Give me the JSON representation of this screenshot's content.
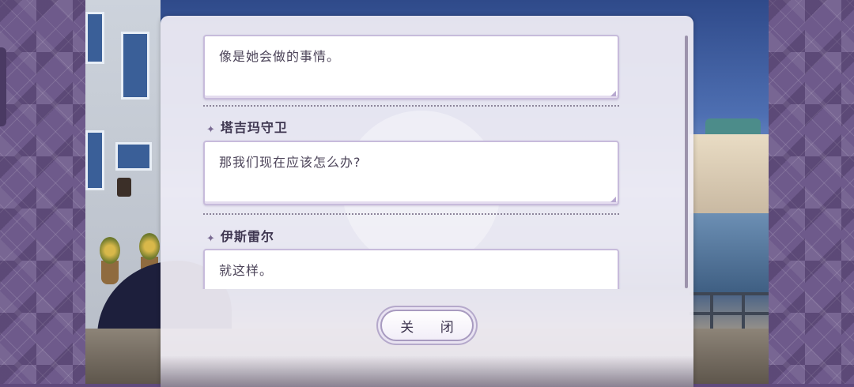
{
  "dialog_log": {
    "entries": [
      {
        "speaker": "",
        "text": "像是她会做的事情。"
      },
      {
        "speaker": "塔吉玛守卫",
        "text": "那我们现在应该怎么办?"
      },
      {
        "speaker": "伊斯雷尔",
        "text": "就这样。"
      }
    ],
    "close_label": "关 闭"
  },
  "icons": {
    "speaker_marker": "four-point-star-icon"
  },
  "colors": {
    "side_pattern": "#6e5a8b",
    "panel_bg": "#f1eef5",
    "textbox_border": "#c7bbdb",
    "text": "#4c4459"
  }
}
